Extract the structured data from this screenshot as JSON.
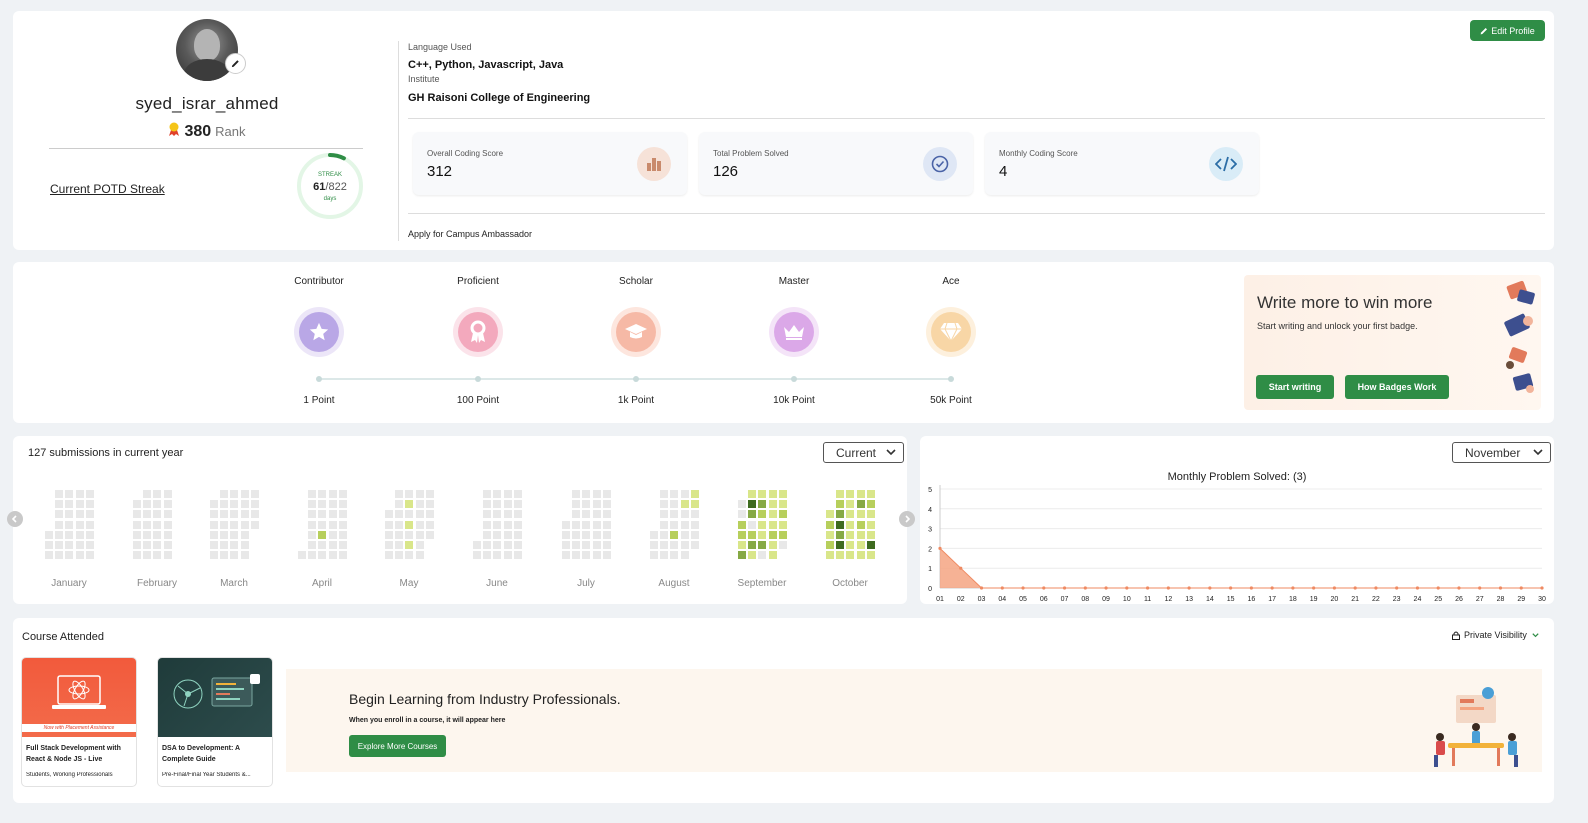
{
  "profile": {
    "username": "syed_israr_ahmed",
    "rank_value": "380",
    "rank_label": "Rank",
    "potd_label": "Current POTD Streak",
    "streak": {
      "label": "STREAK",
      "current": "61",
      "total": "/822",
      "unit": "days",
      "progress": 0.074
    },
    "language_label": "Language Used",
    "languages": "C++, Python, Javascript, Java",
    "institute_label": "Institute",
    "institute": "GH Raisoni College of Engineering",
    "edit_button": "Edit Profile",
    "campus_link": "Apply for Campus Ambassador",
    "stats": [
      {
        "label": "Overall Coding Score",
        "value": "312",
        "icon": "bar-chart-icon"
      },
      {
        "label": "Total Problem Solved",
        "value": "126",
        "icon": "check-circle-icon"
      },
      {
        "label": "Monthly Coding Score",
        "value": "4",
        "icon": "code-icon"
      }
    ]
  },
  "badges": {
    "items": [
      {
        "title": "Contributor",
        "points": "1 Point",
        "icon": "star-icon",
        "color": "#b9a7e6"
      },
      {
        "title": "Proficient",
        "points": "100 Point",
        "icon": "ribbon-icon",
        "color": "#f3a9bd"
      },
      {
        "title": "Scholar",
        "points": "1k Point",
        "icon": "graduation-cap-icon",
        "color": "#f6b9a6"
      },
      {
        "title": "Master",
        "points": "10k Point",
        "icon": "crown-icon",
        "color": "#dba8e8"
      },
      {
        "title": "Ace",
        "points": "50k Point",
        "icon": "diamond-icon",
        "color": "#f8d6a6"
      }
    ],
    "promo": {
      "title": "Write more to win more",
      "subtitle": "Start writing and unlock your first badge.",
      "start_button": "Start writing",
      "how_button": "How Badges Work"
    }
  },
  "submissions": {
    "title": "127 submissions in current year",
    "selector": "Current",
    "months": [
      "January",
      "February",
      "March",
      "April",
      "May",
      "June",
      "July",
      "August",
      "September",
      "October"
    ]
  },
  "monthly": {
    "selector": "November",
    "title": "Monthly Problem Solved: (3)"
  },
  "chart_data": {
    "type": "area",
    "title": "Monthly Problem Solved: (3)",
    "x": [
      "01",
      "02",
      "03",
      "04",
      "05",
      "06",
      "07",
      "08",
      "09",
      "10",
      "11",
      "12",
      "13",
      "14",
      "15",
      "16",
      "17",
      "18",
      "19",
      "20",
      "21",
      "22",
      "23",
      "24",
      "25",
      "26",
      "27",
      "28",
      "29",
      "30"
    ],
    "values": [
      2,
      1,
      0,
      0,
      0,
      0,
      0,
      0,
      0,
      0,
      0,
      0,
      0,
      0,
      0,
      0,
      0,
      0,
      0,
      0,
      0,
      0,
      0,
      0,
      0,
      0,
      0,
      0,
      0,
      0
    ],
    "ylim": [
      0,
      5
    ],
    "yticks": [
      "0",
      "1",
      "2",
      "3",
      "4",
      "5"
    ],
    "grid": true,
    "color": "#f4a582"
  },
  "courses": {
    "title": "Course Attended",
    "visibility": "Private Visibility",
    "items": [
      {
        "name": "Full Stack Development with React & Node JS - Live",
        "audience": "Students, Working Professionals",
        "tag": "Now with Placement Assistance"
      },
      {
        "name": "DSA to Development: A Complete Guide",
        "audience": "Pre-Final/Final Year Students &..."
      }
    ],
    "banner": {
      "title": "Begin Learning from Industry Professionals.",
      "subtitle": "When you enroll in a course, it will appear here",
      "button": "Explore More Courses"
    }
  }
}
